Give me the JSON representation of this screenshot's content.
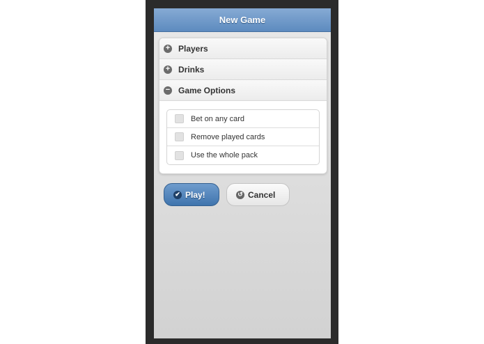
{
  "header": {
    "title": "New Game"
  },
  "accordion": {
    "sections": [
      {
        "label": "Players",
        "icon": "plus-icon",
        "expanded": false
      },
      {
        "label": "Drinks",
        "icon": "plus-icon",
        "expanded": false
      },
      {
        "label": "Game Options",
        "icon": "minus-icon",
        "expanded": true
      }
    ],
    "game_options": [
      {
        "label": "Bet on any card",
        "checked": false
      },
      {
        "label": "Remove played cards",
        "checked": false
      },
      {
        "label": "Use the whole pack",
        "checked": false
      }
    ]
  },
  "buttons": {
    "play_label": "Play!",
    "cancel_label": "Cancel"
  },
  "colors": {
    "header": "#5d8bbf",
    "play_button": "#3f74ad",
    "frame": "#2b2b2b"
  }
}
